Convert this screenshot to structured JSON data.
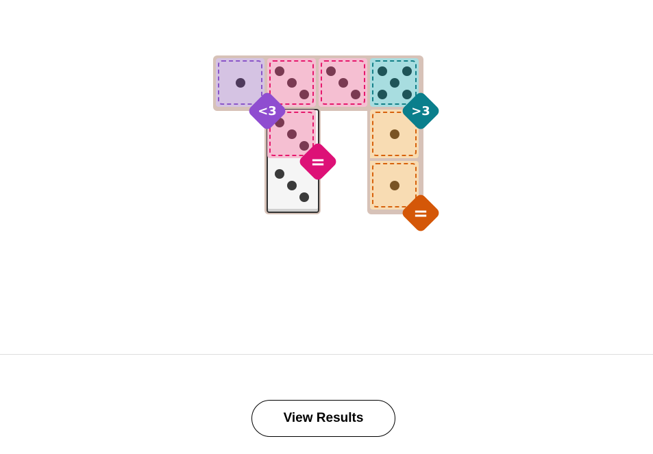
{
  "board": {
    "regions": [
      {
        "id": "purple",
        "rule": "<3",
        "fill": "#d5c3e3",
        "stroke": "#8a55c8",
        "badge_color": "#8f4dd0"
      },
      {
        "id": "pink",
        "rule": "=",
        "fill": "#f5bfd2",
        "stroke": "#e6186d",
        "badge_color": "#dd1177"
      },
      {
        "id": "teal",
        "rule": ">3",
        "fill": "#a8dde0",
        "stroke": "#138088",
        "badge_color": "#0a7f8c"
      },
      {
        "id": "orange",
        "rule": "=",
        "fill": "#f8dcb3",
        "stroke": "#d7620c",
        "badge_color": "#d45708"
      }
    ],
    "cells": [
      {
        "region": "purple",
        "pips": 1
      },
      {
        "region": "pink",
        "pips": 3
      },
      {
        "region": "pink",
        "pips": 3
      },
      {
        "region": "teal",
        "pips": 5
      },
      {
        "region": "pink",
        "pips": 3
      },
      {
        "region": "none",
        "pips": 3
      },
      {
        "region": "orange",
        "pips": 1
      },
      {
        "region": "orange",
        "pips": 1
      }
    ],
    "colors": {
      "frame": "#d7c2b8",
      "pip_purple": "#4e3a5c",
      "pip_pink": "#7a3a52",
      "pip_teal": "#1f5458",
      "pip_orange": "#7a5424",
      "pip_white": "#3a3a3a"
    }
  },
  "footer": {
    "button_label": "View Results"
  }
}
